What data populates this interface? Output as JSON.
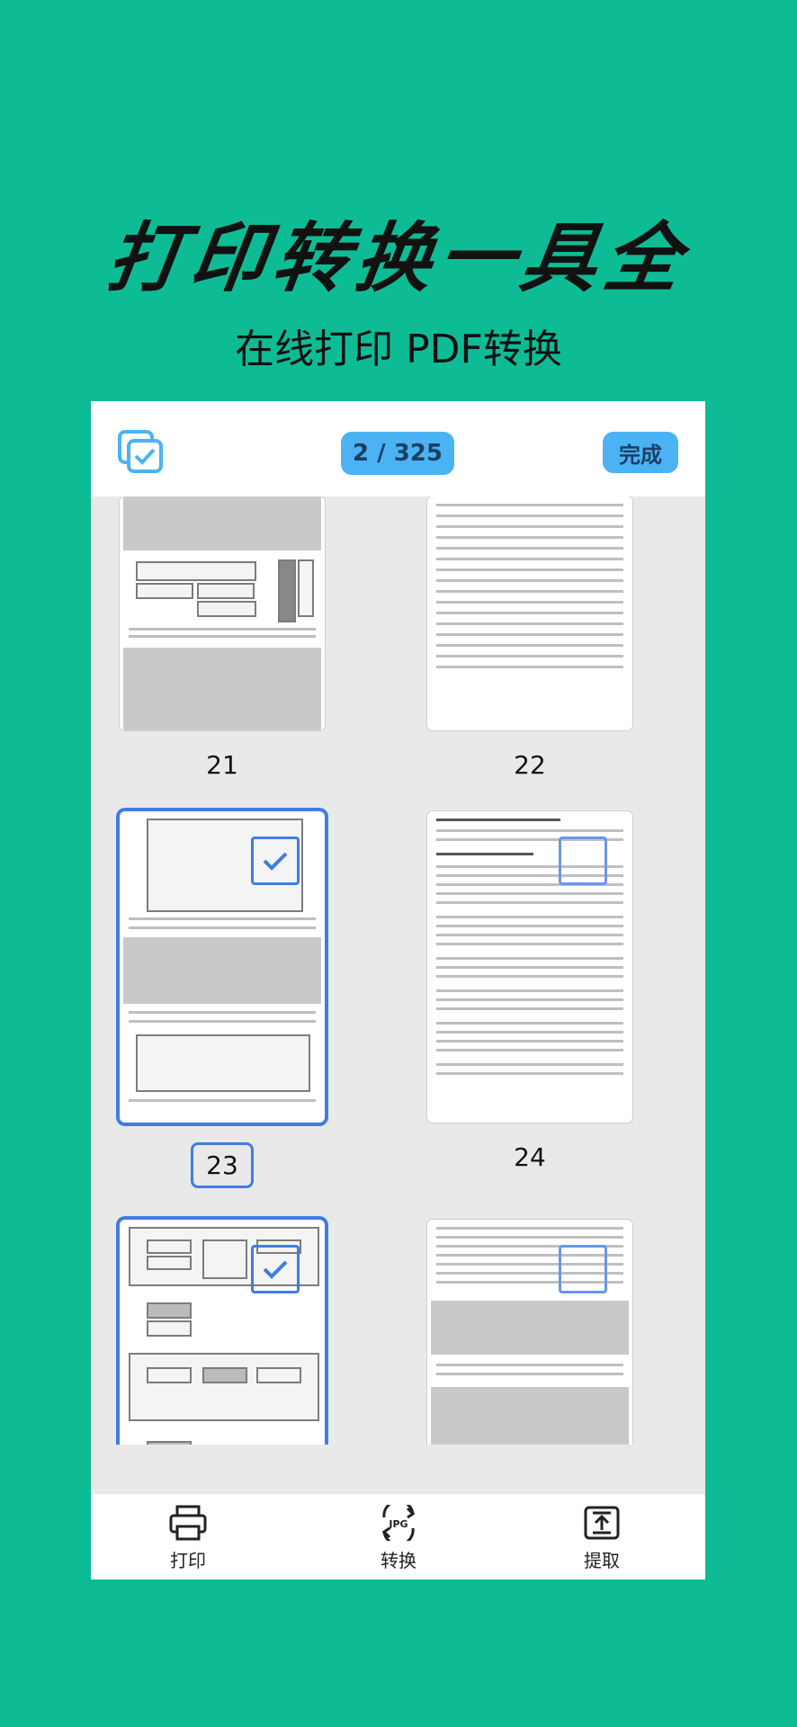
{
  "headline": "打印转换一具全",
  "subline": "在线打印 PDF转换",
  "toolbar": {
    "counter": "2 / 325",
    "done_label": "完成"
  },
  "pages": [
    {
      "number": "21",
      "selected": false
    },
    {
      "number": "22",
      "selected": false
    },
    {
      "number": "23",
      "selected": true
    },
    {
      "number": "24",
      "selected": false
    },
    {
      "number": "",
      "selected": true
    },
    {
      "number": "",
      "selected": false
    }
  ],
  "bottom": {
    "print_label": "打印",
    "convert_label": "转换",
    "convert_badge": "JPG",
    "extract_label": "提取"
  },
  "colors": {
    "background": "#0dbc95",
    "accent": "#4bb3f4",
    "selection": "#3f7ee0"
  }
}
